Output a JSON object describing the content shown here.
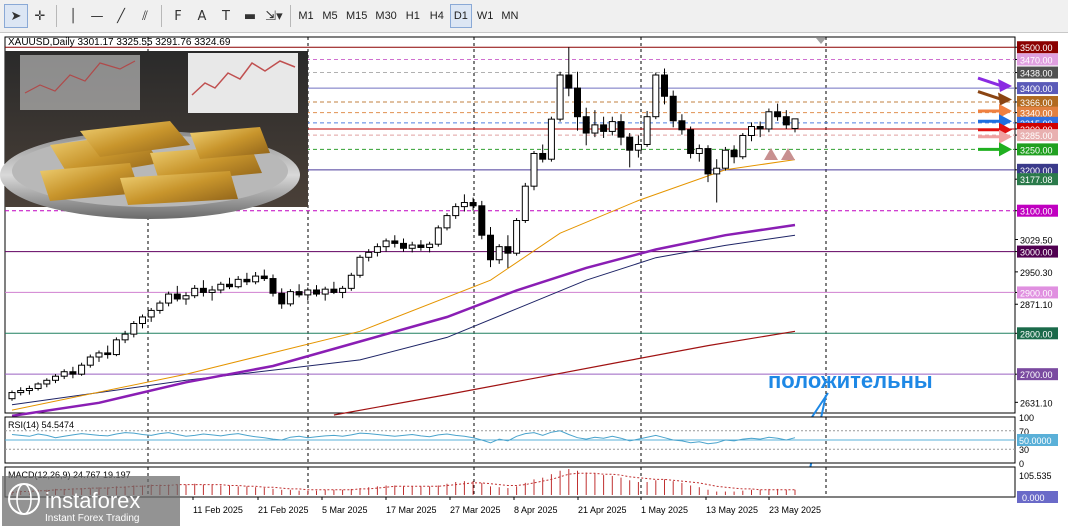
{
  "toolbar": {
    "tools": [
      {
        "name": "cursor-tool",
        "glyph": "➤"
      },
      {
        "name": "crosshair-tool",
        "glyph": "✛"
      },
      {
        "name": "vertical-line-tool",
        "glyph": "│"
      },
      {
        "name": "horizontal-line-tool",
        "glyph": "—"
      },
      {
        "name": "trendline-tool",
        "glyph": "╱"
      },
      {
        "name": "channel-tool",
        "glyph": "⫽"
      },
      {
        "name": "fibonacci-tool",
        "glyph": "F"
      },
      {
        "name": "text-tool",
        "glyph": "A"
      },
      {
        "name": "text-label-tool",
        "glyph": "T"
      },
      {
        "name": "rectangle-tool",
        "glyph": "▬"
      },
      {
        "name": "arrows-tool",
        "glyph": "⇲▾"
      }
    ],
    "timeframes": [
      "M1",
      "M5",
      "M15",
      "M30",
      "H1",
      "H4",
      "D1",
      "W1",
      "MN"
    ],
    "active_timeframe": "D1"
  },
  "chart_info": {
    "symbol_line": "XAUUSD,Daily  3301.17 3325.55 3291.76 3324.69",
    "rsi_label": "RSI(14) 54.5474",
    "macd_label": "MACD(12,26,9) 24.767 19.197",
    "annotation": "положительны",
    "brand_name": "instaforex",
    "brand_tagline": "Instant Forex Trading"
  },
  "colors": {
    "bull_candle": "#2a8a2a",
    "bear_candle": "#000000",
    "ma_fast": "#e59500",
    "ma_mid": "#8a1eb4",
    "ma_slow": "#1e2466",
    "ma_200": "#a01212",
    "rsi_line": "#4aa3cc",
    "annotation": "#1e88e5"
  },
  "chart_data": {
    "type": "candlestick",
    "series_name": "XAUUSD,Daily",
    "ylim": [
      2605,
      3525
    ],
    "price_ticks": [
      "3500.00",
      "3470.00",
      "3438.00",
      "3400.00",
      "3366.00",
      "3340.00",
      "3315.00",
      "3300.00",
      "3285.00",
      "3250.00",
      "3200.00",
      "3177.08",
      "3100.00",
      "3029.50",
      "3000.00",
      "2950.30",
      "2900.00",
      "2871.10",
      "2800.00",
      "2700.00",
      "2631.10"
    ],
    "x_ticks": [
      "11 Feb 2025",
      "21 Feb 2025",
      "5 Mar 2025",
      "17 Mar 2025",
      "27 Mar 2025",
      "8 Apr 2025",
      "21 Apr 2025",
      "1 May 2025",
      "13 May 2025",
      "23 May 2025"
    ],
    "levels": [
      {
        "price": 3500.0,
        "label": "3500.00",
        "color": "#8b0000",
        "style": "solid",
        "badge": "#8b0000",
        "badge_text": "#ffffff"
      },
      {
        "price": 3470.0,
        "label": "3470.00",
        "color": "#d070d0",
        "style": "dashed",
        "badge": "#e0a0e0",
        "badge_text": "#ffffff"
      },
      {
        "price": 3438.0,
        "label": "3438.00",
        "color": "#b0b0b0",
        "style": "dashed",
        "badge": "#505050",
        "badge_text": "#ffffff"
      },
      {
        "price": 3400.0,
        "label": "3400.00",
        "color": "#7070c0",
        "style": "solid",
        "badge": "#5a5ab8",
        "badge_text": "#ffffff"
      },
      {
        "price": 3366.0,
        "label": "3366.00",
        "color": "#c08040",
        "style": "dashed",
        "badge": "#b06a20",
        "badge_text": "#ffffff"
      },
      {
        "price": 3340.0,
        "label": "3340.00",
        "color": "#e09050",
        "style": "dashed",
        "badge": "#e08040",
        "badge_text": "#ffffff"
      },
      {
        "price": 3315.0,
        "label": "3315.00",
        "color": "#5080e0",
        "style": "dashed",
        "badge": "#3070e0",
        "badge_text": "#ffffff"
      },
      {
        "price": 3300.0,
        "label": "3300.00",
        "color": "#c00000",
        "style": "solid",
        "badge": "#d00000",
        "badge_text": "#ffffff"
      },
      {
        "price": 3285.0,
        "label": "3285.00",
        "color": "#e0a0a0",
        "style": "dashed",
        "badge": "#e8b0b0",
        "badge_text": "#ffffff"
      },
      {
        "price": 3250.0,
        "label": "3250.00",
        "color": "#30a030",
        "style": "dashed",
        "badge": "#20a020",
        "badge_text": "#ffffff"
      },
      {
        "price": 3200.0,
        "label": "3200.00",
        "color": "#4a3a9a",
        "style": "solid",
        "badge": "#3a3a8a",
        "badge_text": "#ffffff"
      },
      {
        "price": 3177.08,
        "label": "3177.08",
        "color": "#70b070",
        "style": "none",
        "badge": "#2a7a4a",
        "badge_text": "#ffffff"
      },
      {
        "price": 3100.0,
        "label": "3100.00",
        "color": "#c000c0",
        "style": "dashed",
        "badge": "#c000c0",
        "badge_text": "#ffffff"
      },
      {
        "price": 3000.0,
        "label": "3000.00",
        "color": "#600060",
        "style": "solid",
        "badge": "#500050",
        "badge_text": "#ffffff"
      },
      {
        "price": 2900.0,
        "label": "2900.00",
        "color": "#d080d0",
        "style": "solid",
        "badge": "#e090e0",
        "badge_text": "#ffffff"
      },
      {
        "price": 2800.0,
        "label": "2800.00",
        "color": "#208060",
        "style": "solid",
        "badge": "#1a6a4a",
        "badge_text": "#ffffff"
      },
      {
        "price": 2700.0,
        "label": "2700.00",
        "color": "#9a60c0",
        "style": "solid",
        "badge": "#7a4aa0",
        "badge_text": "#ffffff"
      }
    ],
    "candles": [
      [
        2640,
        2660,
        2635,
        2655
      ],
      [
        2655,
        2668,
        2648,
        2660
      ],
      [
        2660,
        2672,
        2650,
        2665
      ],
      [
        2665,
        2680,
        2660,
        2676
      ],
      [
        2676,
        2690,
        2668,
        2685
      ],
      [
        2685,
        2700,
        2678,
        2695
      ],
      [
        2695,
        2712,
        2688,
        2706
      ],
      [
        2706,
        2718,
        2690,
        2700
      ],
      [
        2700,
        2728,
        2696,
        2722
      ],
      [
        2722,
        2748,
        2716,
        2742
      ],
      [
        2742,
        2758,
        2730,
        2752
      ],
      [
        2752,
        2770,
        2738,
        2748
      ],
      [
        2748,
        2790,
        2744,
        2784
      ],
      [
        2784,
        2806,
        2776,
        2798
      ],
      [
        2798,
        2830,
        2790,
        2824
      ],
      [
        2824,
        2846,
        2812,
        2840
      ],
      [
        2840,
        2862,
        2828,
        2856
      ],
      [
        2856,
        2880,
        2848,
        2874
      ],
      [
        2874,
        2902,
        2866,
        2896
      ],
      [
        2896,
        2916,
        2878,
        2884
      ],
      [
        2884,
        2900,
        2870,
        2892
      ],
      [
        2892,
        2918,
        2886,
        2910
      ],
      [
        2910,
        2930,
        2890,
        2900
      ],
      [
        2900,
        2916,
        2880,
        2906
      ],
      [
        2906,
        2926,
        2898,
        2920
      ],
      [
        2920,
        2936,
        2908,
        2914
      ],
      [
        2914,
        2940,
        2910,
        2932
      ],
      [
        2932,
        2948,
        2918,
        2926
      ],
      [
        2926,
        2950,
        2920,
        2940
      ],
      [
        2940,
        2956,
        2928,
        2934
      ],
      [
        2934,
        2944,
        2890,
        2898
      ],
      [
        2898,
        2910,
        2860,
        2872
      ],
      [
        2872,
        2908,
        2866,
        2902
      ],
      [
        2902,
        2920,
        2888,
        2894
      ],
      [
        2894,
        2912,
        2880,
        2906
      ],
      [
        2906,
        2918,
        2890,
        2896
      ],
      [
        2896,
        2914,
        2880,
        2908
      ],
      [
        2908,
        2926,
        2896,
        2900
      ],
      [
        2900,
        2916,
        2886,
        2910
      ],
      [
        2910,
        2948,
        2904,
        2942
      ],
      [
        2942,
        2992,
        2936,
        2986
      ],
      [
        2986,
        3006,
        2976,
        2998
      ],
      [
        2998,
        3020,
        2988,
        3012
      ],
      [
        3012,
        3032,
        3000,
        3026
      ],
      [
        3026,
        3040,
        3010,
        3020
      ],
      [
        3020,
        3032,
        3000,
        3008
      ],
      [
        3008,
        3024,
        2998,
        3016
      ],
      [
        3016,
        3028,
        3002,
        3010
      ],
      [
        3010,
        3024,
        2998,
        3018
      ],
      [
        3018,
        3064,
        3012,
        3058
      ],
      [
        3058,
        3094,
        3052,
        3088
      ],
      [
        3088,
        3118,
        3080,
        3110
      ],
      [
        3110,
        3140,
        3098,
        3120
      ],
      [
        3120,
        3132,
        3100,
        3112
      ],
      [
        3112,
        3124,
        3030,
        3040
      ],
      [
        3040,
        3060,
        2962,
        2980
      ],
      [
        2980,
        3018,
        2970,
        3012
      ],
      [
        3012,
        3040,
        2960,
        2996
      ],
      [
        2996,
        3082,
        2990,
        3076
      ],
      [
        3076,
        3168,
        3070,
        3160
      ],
      [
        3160,
        3246,
        3150,
        3240
      ],
      [
        3240,
        3262,
        3218,
        3226
      ],
      [
        3226,
        3330,
        3220,
        3324
      ],
      [
        3324,
        3440,
        3318,
        3432
      ],
      [
        3432,
        3500,
        3380,
        3400
      ],
      [
        3400,
        3440,
        3296,
        3330
      ],
      [
        3330,
        3352,
        3260,
        3290
      ],
      [
        3290,
        3346,
        3280,
        3310
      ],
      [
        3310,
        3330,
        3278,
        3294
      ],
      [
        3294,
        3330,
        3284,
        3318
      ],
      [
        3318,
        3336,
        3260,
        3280
      ],
      [
        3280,
        3290,
        3206,
        3248
      ],
      [
        3248,
        3284,
        3230,
        3262
      ],
      [
        3262,
        3344,
        3256,
        3330
      ],
      [
        3330,
        3438,
        3324,
        3432
      ],
      [
        3432,
        3448,
        3360,
        3380
      ],
      [
        3380,
        3394,
        3304,
        3320
      ],
      [
        3320,
        3336,
        3286,
        3298
      ],
      [
        3298,
        3306,
        3228,
        3240
      ],
      [
        3240,
        3262,
        3220,
        3252
      ],
      [
        3252,
        3260,
        3170,
        3190
      ],
      [
        3190,
        3226,
        3120,
        3204
      ],
      [
        3204,
        3256,
        3198,
        3248
      ],
      [
        3248,
        3260,
        3216,
        3232
      ],
      [
        3232,
        3290,
        3226,
        3284
      ],
      [
        3284,
        3316,
        3270,
        3306
      ],
      [
        3306,
        3318,
        3280,
        3300
      ],
      [
        3300,
        3350,
        3292,
        3342
      ],
      [
        3342,
        3362,
        3320,
        3330
      ],
      [
        3330,
        3346,
        3300,
        3310
      ],
      [
        3301.17,
        3325.55,
        3291.76,
        3324.69
      ]
    ],
    "ma_fast": [
      [
        0,
        2612
      ],
      [
        20,
        2700
      ],
      [
        40,
        2805
      ],
      [
        55,
        2930
      ],
      [
        63,
        3045
      ],
      [
        72,
        3125
      ],
      [
        82,
        3200
      ],
      [
        90,
        3225
      ]
    ],
    "ma_mid": [
      [
        0,
        2598
      ],
      [
        10,
        2630
      ],
      [
        20,
        2680
      ],
      [
        30,
        2720
      ],
      [
        40,
        2780
      ],
      [
        50,
        2840
      ],
      [
        58,
        2905
      ],
      [
        66,
        2960
      ],
      [
        74,
        3005
      ],
      [
        82,
        3040
      ],
      [
        90,
        3065
      ]
    ],
    "ma_slow": [
      [
        0,
        2625
      ],
      [
        20,
        2685
      ],
      [
        40,
        2735
      ],
      [
        50,
        2790
      ],
      [
        58,
        2860
      ],
      [
        66,
        2930
      ],
      [
        74,
        2985
      ],
      [
        82,
        3015
      ],
      [
        90,
        3040
      ]
    ],
    "ma_200": [
      [
        37,
        2600
      ],
      [
        50,
        2650
      ],
      [
        60,
        2690
      ],
      [
        70,
        2730
      ],
      [
        80,
        2770
      ],
      [
        90,
        2805
      ]
    ],
    "arrows": [
      {
        "price": 3405,
        "color": "#8a2be2",
        "from": "right"
      },
      {
        "price": 3372,
        "color": "#8b4513",
        "from": "right"
      },
      {
        "price": 3344,
        "color": "#f08040",
        "from": "left"
      },
      {
        "price": 3319,
        "color": "#1e6fe0",
        "from": "left"
      },
      {
        "price": 3298,
        "color": "#e01010",
        "from": "left"
      },
      {
        "price": 3281,
        "color": "#f0a0a0",
        "from": "left"
      },
      {
        "price": 3250,
        "color": "#20b020",
        "from": "left"
      }
    ],
    "rsi": {
      "ylim": [
        0,
        100
      ],
      "ticks": [
        "100",
        "70",
        "50",
        "30",
        "0"
      ],
      "level_badge": "50.0000",
      "values": [
        62,
        60,
        58,
        63,
        60,
        55,
        58,
        61,
        64,
        62,
        60,
        59,
        63,
        66,
        65,
        62,
        60,
        64,
        66,
        62,
        58,
        60,
        63,
        61,
        59,
        62,
        64,
        60,
        57,
        55,
        52,
        50,
        56,
        58,
        55,
        57,
        59,
        60,
        58,
        61,
        65,
        64,
        62,
        60,
        58,
        60,
        62,
        59,
        57,
        61,
        63,
        60,
        58,
        55,
        50,
        44,
        52,
        48,
        58,
        64,
        66,
        60,
        67,
        70,
        62,
        55,
        52,
        56,
        54,
        58,
        54,
        48,
        52,
        56,
        60,
        55,
        50,
        48,
        44,
        46,
        42,
        44,
        50,
        48,
        52,
        54,
        52,
        56,
        54,
        50,
        55
      ]
    },
    "macd": {
      "ticks": [
        "105.535",
        "0.000"
      ],
      "bars": [
        4,
        5,
        5,
        6,
        6,
        7,
        7,
        7,
        8,
        8,
        9,
        9,
        10,
        10,
        11,
        11,
        12,
        12,
        12,
        12,
        12,
        13,
        12,
        12,
        11,
        11,
        10,
        10,
        9,
        8,
        7,
        6,
        6,
        5,
        5,
        5,
        6,
        6,
        6,
        7,
        8,
        9,
        10,
        11,
        11,
        10,
        10,
        10,
        10,
        11,
        13,
        15,
        16,
        16,
        14,
        10,
        9,
        8,
        10,
        14,
        18,
        20,
        24,
        28,
        30,
        28,
        26,
        25,
        23,
        22,
        20,
        17,
        15,
        15,
        17,
        18,
        16,
        14,
        11,
        9,
        6,
        4,
        4,
        4,
        5,
        6,
        6,
        7,
        7,
        6,
        6
      ],
      "signal": [
        3,
        4,
        4,
        5,
        5,
        6,
        6,
        7,
        7,
        8,
        8,
        8,
        9,
        9,
        10,
        10,
        11,
        11,
        11,
        12,
        12,
        12,
        12,
        12,
        12,
        11,
        11,
        10,
        10,
        9,
        9,
        8,
        7,
        7,
        6,
        6,
        6,
        6,
        6,
        6,
        7,
        7,
        8,
        9,
        10,
        10,
        10,
        10,
        10,
        10,
        11,
        12,
        13,
        14,
        14,
        13,
        12,
        11,
        11,
        12,
        14,
        16,
        18,
        21,
        24,
        25,
        25,
        25,
        24,
        24,
        23,
        21,
        20,
        19,
        18,
        18,
        17,
        16,
        15,
        14,
        12,
        10,
        9,
        8,
        7,
        7,
        6,
        6,
        6,
        6,
        6
      ]
    }
  }
}
